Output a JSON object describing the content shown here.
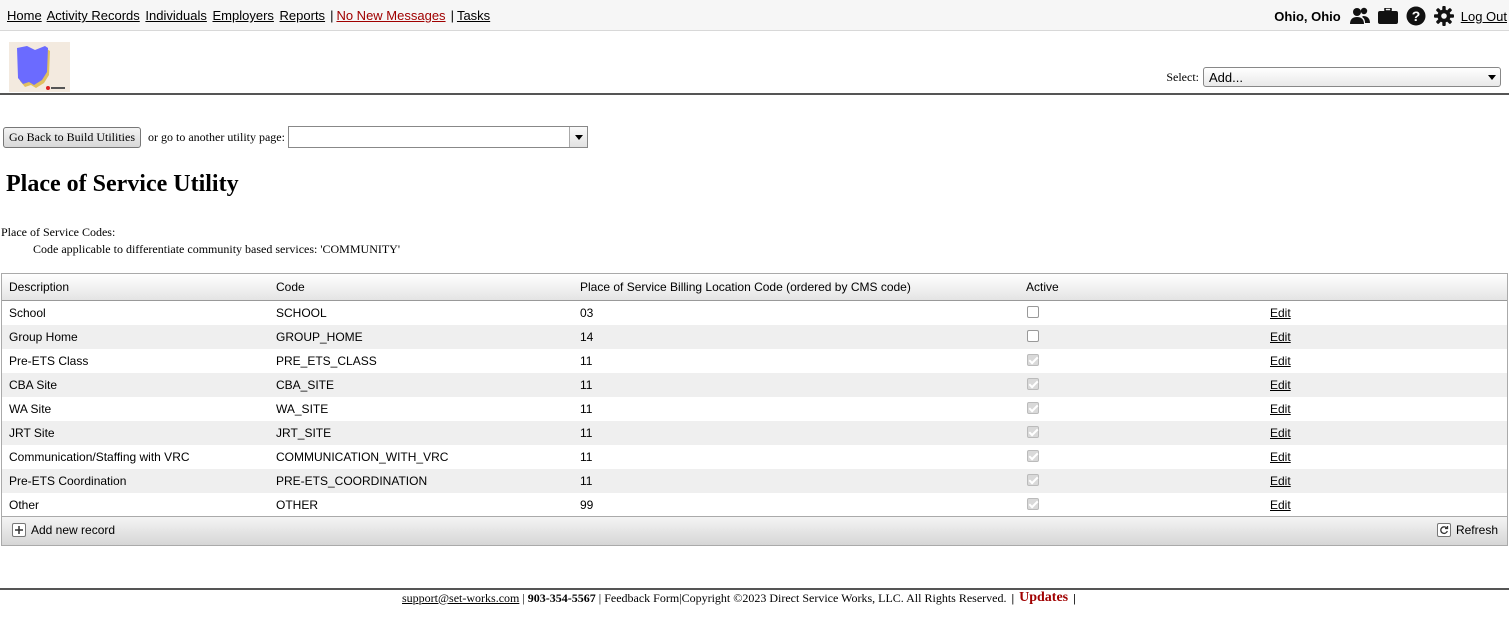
{
  "nav": {
    "links": [
      "Home",
      "Activity Records",
      "Individuals",
      "Employers",
      "Reports"
    ],
    "messages": "No New Messages",
    "tasks": "Tasks",
    "sep": "|",
    "user": "Ohio, Ohio",
    "logout": "Log Out"
  },
  "header": {
    "select_label": "Select:",
    "select_value": "Add..."
  },
  "utility": {
    "back_button": "Go Back to Build Utilities",
    "or_text": "or go to another utility page:",
    "page_select_value": ""
  },
  "page_title": "Place of Service Utility",
  "codes": {
    "heading": "Place of Service Codes:",
    "community": "Code applicable to differentiate community based services: 'COMMUNITY'"
  },
  "grid": {
    "columns": [
      "Description",
      "Code",
      "Place of Service Billing Location Code (ordered by CMS code)",
      "Active"
    ],
    "rows": [
      {
        "desc": "School",
        "code": "SCHOOL",
        "loc": "03",
        "active": false,
        "edit": "Edit"
      },
      {
        "desc": "Group Home",
        "code": "GROUP_HOME",
        "loc": "14",
        "active": false,
        "edit": "Edit"
      },
      {
        "desc": "Pre-ETS Class",
        "code": "PRE_ETS_CLASS",
        "loc": "11",
        "active": true,
        "edit": "Edit"
      },
      {
        "desc": "CBA Site",
        "code": "CBA_SITE",
        "loc": "11",
        "active": true,
        "edit": "Edit"
      },
      {
        "desc": "WA Site",
        "code": "WA_SITE",
        "loc": "11",
        "active": true,
        "edit": "Edit"
      },
      {
        "desc": "JRT Site",
        "code": "JRT_SITE",
        "loc": "11",
        "active": true,
        "edit": "Edit"
      },
      {
        "desc": "Communication/Staffing with VRC",
        "code": "COMMUNICATION_WITH_VRC",
        "loc": "11",
        "active": true,
        "edit": "Edit"
      },
      {
        "desc": "Pre-ETS Coordination",
        "code": "PRE-ETS_COORDINATION",
        "loc": "11",
        "active": true,
        "edit": "Edit"
      },
      {
        "desc": "Other",
        "code": "OTHER",
        "loc": "99",
        "active": true,
        "edit": "Edit"
      }
    ],
    "add_label": "Add new record",
    "refresh_label": "Refresh"
  },
  "footer": {
    "email": "support@set-works.com",
    "phone": "903-354-5567",
    "feedback": "Feedback Form",
    "copyright": "Copyright ©2023 Direct Service Works, LLC. All Rights Reserved.",
    "updates": "Updates",
    "sep": "|"
  },
  "colors": {
    "accent_red": "#a00000",
    "logo_state": "#6b6bff"
  },
  "icons": [
    "people-icon",
    "briefcase-icon",
    "help-icon",
    "gear-icon",
    "plus-icon",
    "refresh-icon"
  ]
}
